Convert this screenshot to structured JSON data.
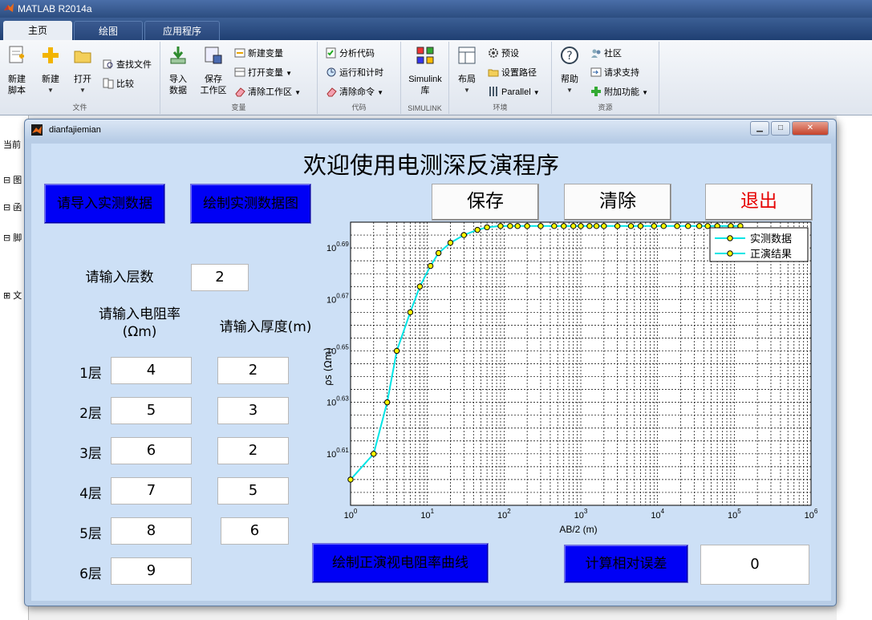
{
  "app": {
    "window_title": "MATLAB R2014a",
    "tabs": [
      "主页",
      "绘图",
      "应用程序"
    ]
  },
  "ribbon": {
    "file": {
      "label": "文件",
      "new_script": "新建\n脚本",
      "new": "新建",
      "open": "打开",
      "find_files": "查找文件",
      "compare": "比较"
    },
    "variable": {
      "label": "变量",
      "import": "导入\n数据",
      "save_ws": "保存\n工作区",
      "new_var": "新建变量",
      "open_var": "打开变量",
      "clear_ws": "清除工作区"
    },
    "code": {
      "label": "代码",
      "analyze": "分析代码",
      "run_time": "运行和计时",
      "clear_cmd": "清除命令"
    },
    "simulink": {
      "label": "SIMULINK",
      "btn": "Simulink\n库"
    },
    "env": {
      "label": "环境",
      "layout": "布局",
      "prefs": "预设",
      "set_path": "设置路径",
      "parallel": "Parallel"
    },
    "resources": {
      "label": "资源",
      "help": "帮助",
      "community": "社区",
      "support": "请求支持",
      "addons": "附加功能"
    }
  },
  "left_panel": [
    "当前",
    "图",
    "函",
    "脚",
    "文"
  ],
  "figure": {
    "title": "dianfajiemian",
    "heading": "欢迎使用电测深反演程序",
    "buttons": {
      "import": "请导入实测数据",
      "plot_measured": "绘制实测数据图",
      "save": "保存",
      "clear": "清除",
      "exit": "退出",
      "forward": "绘制正演视电阻率曲线",
      "rel_error": "计算相对误差"
    },
    "layers_prompt": "请输入层数",
    "layers_value": "2",
    "resistivity_label": "请输入电阻率\n(Ωm)",
    "thickness_label": "请输入厚度(m)",
    "layers": [
      {
        "label": "1层",
        "rho": "4",
        "h": "2"
      },
      {
        "label": "2层",
        "rho": "5",
        "h": "3"
      },
      {
        "label": "3层",
        "rho": "6",
        "h": "2"
      },
      {
        "label": "4层",
        "rho": "7",
        "h": "5"
      },
      {
        "label": "5层",
        "rho": "8",
        "h": "6"
      },
      {
        "label": "6层",
        "rho": "9",
        "h": ""
      }
    ],
    "error_value": "0",
    "colors": {
      "blue_btn": "#0000f5",
      "exit_text": "#e60000",
      "curve": "#00e5e5",
      "marker": "#ffff00"
    }
  },
  "chart_data": {
    "type": "line",
    "xlabel": "AB/2 (m)",
    "ylabel": "ρs (Ωm)",
    "x_scale": "log",
    "y_scale": "log",
    "xlim": [
      1,
      1000000
    ],
    "ylim_exp": [
      0.59,
      0.7
    ],
    "x_ticks": [
      "10^0",
      "10^1",
      "10^2",
      "10^3",
      "10^4",
      "10^5",
      "10^6"
    ],
    "y_ticks": [
      "10^0.61",
      "10^0.63",
      "10^0.65",
      "10^0.67",
      "10^0.69"
    ],
    "grid": true,
    "legend_position": "top-right",
    "series": [
      {
        "name": "实测数据",
        "color": "#00e5e5",
        "marker": "o",
        "marker_face": "#ffff00"
      },
      {
        "name": "正演结果",
        "color": "#00e5e5",
        "marker": "o",
        "marker_face": "#ffff00"
      }
    ],
    "points": [
      [
        1,
        0.6
      ],
      [
        2,
        0.61
      ],
      [
        3,
        0.63
      ],
      [
        4,
        0.65
      ],
      [
        6,
        0.665
      ],
      [
        8,
        0.675
      ],
      [
        11,
        0.683
      ],
      [
        14,
        0.688
      ],
      [
        20,
        0.692
      ],
      [
        30,
        0.695
      ],
      [
        45,
        0.697
      ],
      [
        60,
        0.698
      ],
      [
        90,
        0.6985
      ],
      [
        120,
        0.6985
      ],
      [
        150,
        0.6985
      ],
      [
        200,
        0.6985
      ],
      [
        300,
        0.6985
      ],
      [
        450,
        0.6985
      ],
      [
        600,
        0.6985
      ],
      [
        800,
        0.6985
      ],
      [
        1000,
        0.6985
      ],
      [
        1300,
        0.6985
      ],
      [
        1600,
        0.6985
      ],
      [
        2000,
        0.6985
      ],
      [
        3000,
        0.6985
      ],
      [
        4500,
        0.6985
      ],
      [
        6000,
        0.6985
      ],
      [
        9000,
        0.6985
      ],
      [
        12000,
        0.6985
      ],
      [
        18000,
        0.6985
      ],
      [
        25000,
        0.6985
      ],
      [
        35000,
        0.6985
      ],
      [
        45000,
        0.6985
      ],
      [
        60000,
        0.6985
      ],
      [
        90000,
        0.6985
      ],
      [
        120000,
        0.6985
      ]
    ]
  }
}
